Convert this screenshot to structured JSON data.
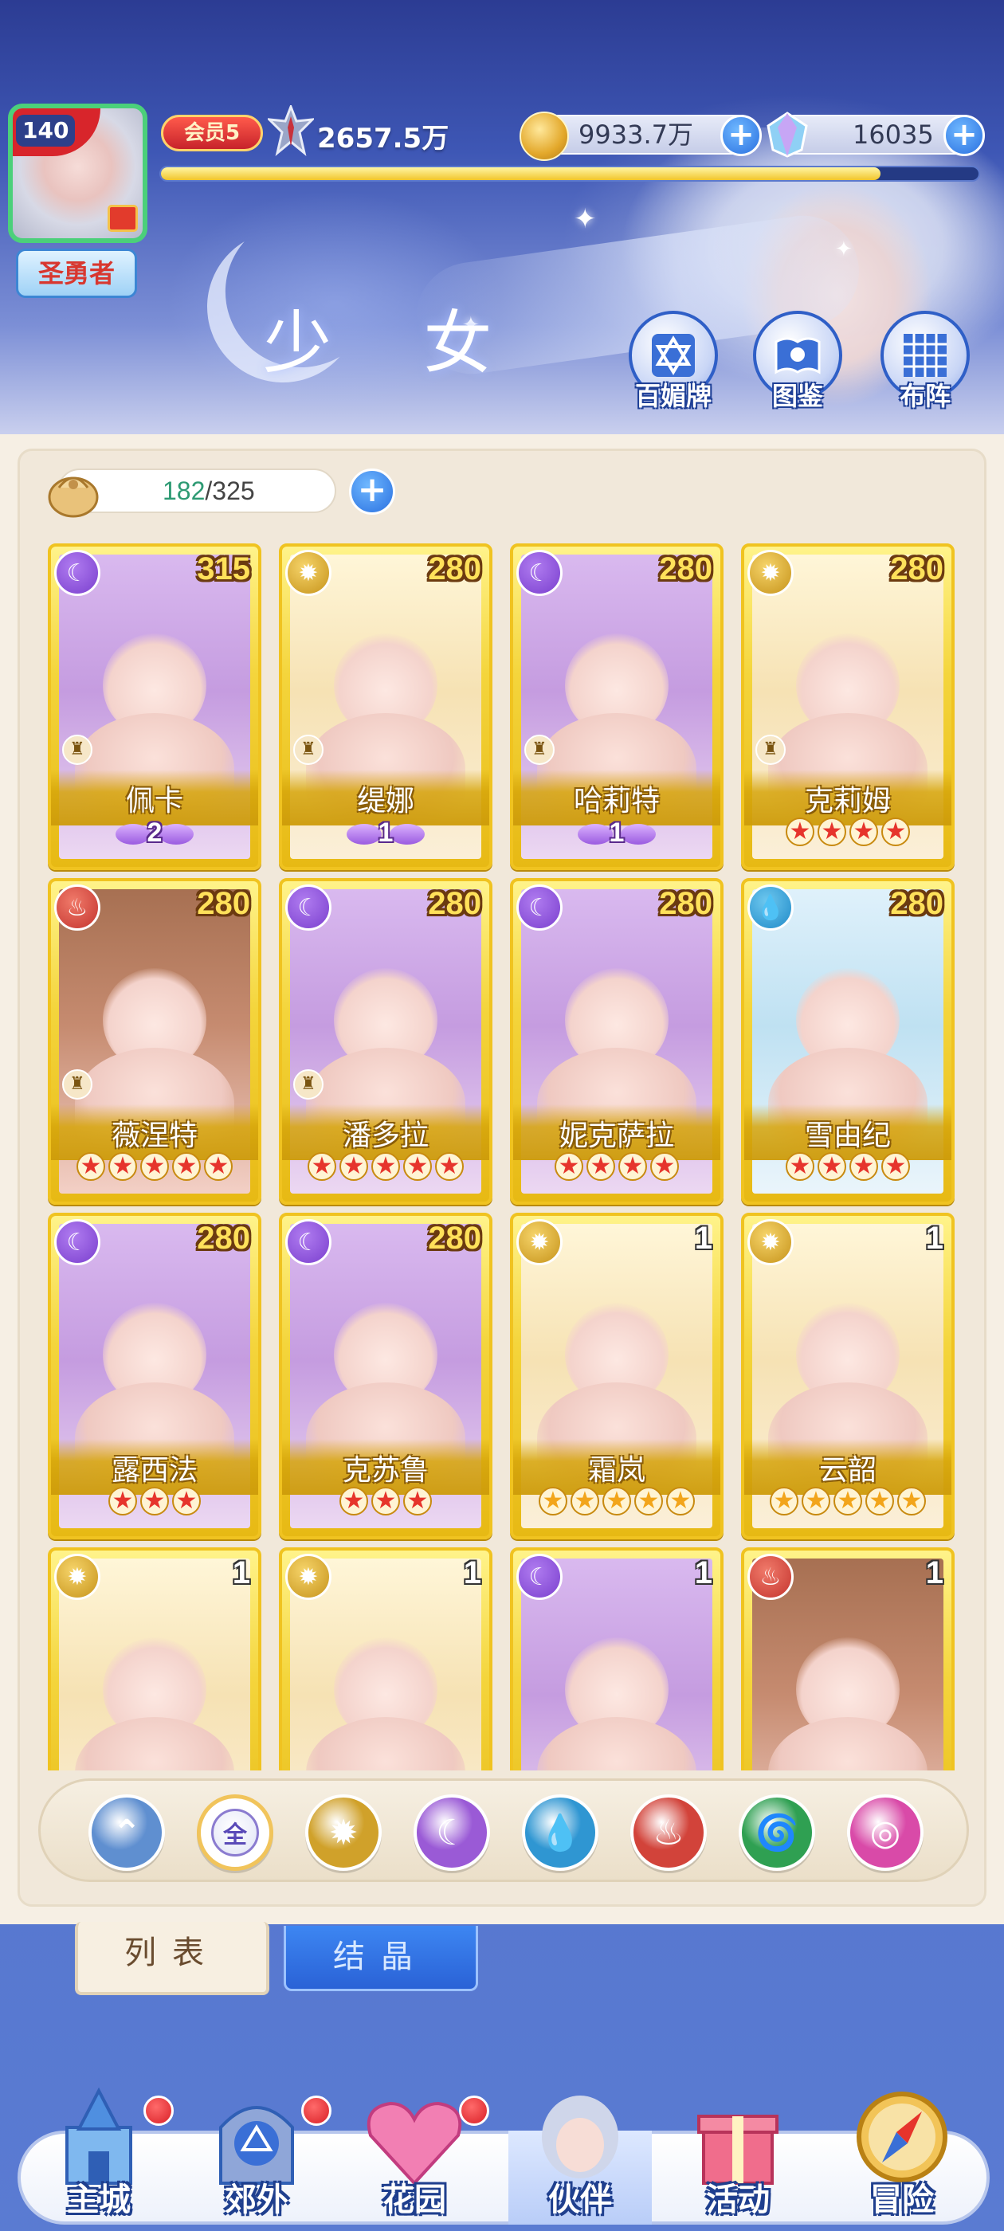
{
  "header": {
    "player_level": "140",
    "player_title": "圣勇者",
    "vip_label": "会员5",
    "power": "2657.5万",
    "coins": "9933.7万",
    "gems": "16035",
    "xp_progress": 0.88,
    "page_title": "少 女",
    "buttons": [
      {
        "label": "百媚牌",
        "icon": "hexagram-card-icon"
      },
      {
        "label": "图鉴",
        "icon": "book-icon"
      },
      {
        "label": "布阵",
        "icon": "grid-formation-icon"
      }
    ]
  },
  "inventory": {
    "current": "182",
    "separator": "/",
    "max": "325"
  },
  "cards": [
    {
      "name": "佩卡",
      "level": "315",
      "element": "moon",
      "stars_type": "wing",
      "wing_count": "2",
      "rook": true
    },
    {
      "name": "缇娜",
      "level": "280",
      "element": "sun",
      "stars_type": "wing",
      "wing_count": "1",
      "rook": true
    },
    {
      "name": "哈莉特",
      "level": "280",
      "element": "moon",
      "stars_type": "wing",
      "wing_count": "1",
      "rook": true
    },
    {
      "name": "克莉姆",
      "level": "280",
      "element": "sun",
      "stars_type": "red",
      "star_count": 4,
      "rook": true
    },
    {
      "name": "薇涅特",
      "level": "280",
      "element": "fire",
      "stars_type": "red",
      "star_count": 5,
      "rook": true
    },
    {
      "name": "潘多拉",
      "level": "280",
      "element": "moon",
      "stars_type": "red",
      "star_count": 5,
      "rook": true
    },
    {
      "name": "妮克萨拉",
      "level": "280",
      "element": "moon",
      "stars_type": "red",
      "star_count": 4,
      "rook": false
    },
    {
      "name": "雪由纪",
      "level": "280",
      "element": "water",
      "stars_type": "red",
      "star_count": 4,
      "rook": false
    },
    {
      "name": "露西法",
      "level": "280",
      "element": "moon",
      "stars_type": "red",
      "star_count": 3,
      "rook": false
    },
    {
      "name": "克苏鲁",
      "level": "280",
      "element": "moon",
      "stars_type": "red",
      "star_count": 3,
      "rook": false
    },
    {
      "name": "霜岚",
      "level": "1",
      "element": "sun",
      "stars_type": "gold",
      "star_count": 5,
      "rook": false
    },
    {
      "name": "云韶",
      "level": "1",
      "element": "sun",
      "stars_type": "gold",
      "star_count": 5,
      "rook": false
    },
    {
      "name": "",
      "level": "1",
      "element": "sun",
      "stars_type": "none",
      "rook": false
    },
    {
      "name": "",
      "level": "1",
      "element": "sun",
      "stars_type": "none",
      "rook": false
    },
    {
      "name": "",
      "level": "1",
      "element": "moon",
      "stars_type": "none",
      "rook": false
    },
    {
      "name": "",
      "level": "1",
      "element": "fire",
      "stars_type": "none",
      "rook": false
    }
  ],
  "filters": [
    {
      "id": "special",
      "icon": "wing-spark-icon",
      "color": "#5f8fd0"
    },
    {
      "id": "all",
      "label": "全",
      "icon": "all-icon",
      "selected": true
    },
    {
      "id": "sun",
      "icon": "sun-icon",
      "color": "#d0a12a"
    },
    {
      "id": "moon",
      "icon": "moon-icon",
      "color": "#9a5ad6"
    },
    {
      "id": "water",
      "icon": "water-drop-icon",
      "color": "#2f96d2"
    },
    {
      "id": "fire",
      "icon": "fire-icon",
      "color": "#d2433a"
    },
    {
      "id": "wind",
      "icon": "whirlwind-icon",
      "color": "#2fa052"
    },
    {
      "id": "void",
      "icon": "orbit-icon",
      "color": "#d94aa8"
    }
  ],
  "tabs": {
    "list": "列表",
    "crystal": "结晶"
  },
  "bottom_nav": [
    {
      "label": "主城",
      "icon": "castle-icon",
      "badge": true
    },
    {
      "label": "郊外",
      "icon": "portal-icon",
      "badge": true
    },
    {
      "label": "花园",
      "icon": "heart-garden-icon",
      "badge": true
    },
    {
      "label": "伙伴",
      "icon": "partner-avatar-icon",
      "badge": false,
      "active": true
    },
    {
      "label": "活动",
      "icon": "gift-box-icon",
      "badge": false
    },
    {
      "label": "冒险",
      "icon": "compass-icon",
      "badge": false
    }
  ]
}
